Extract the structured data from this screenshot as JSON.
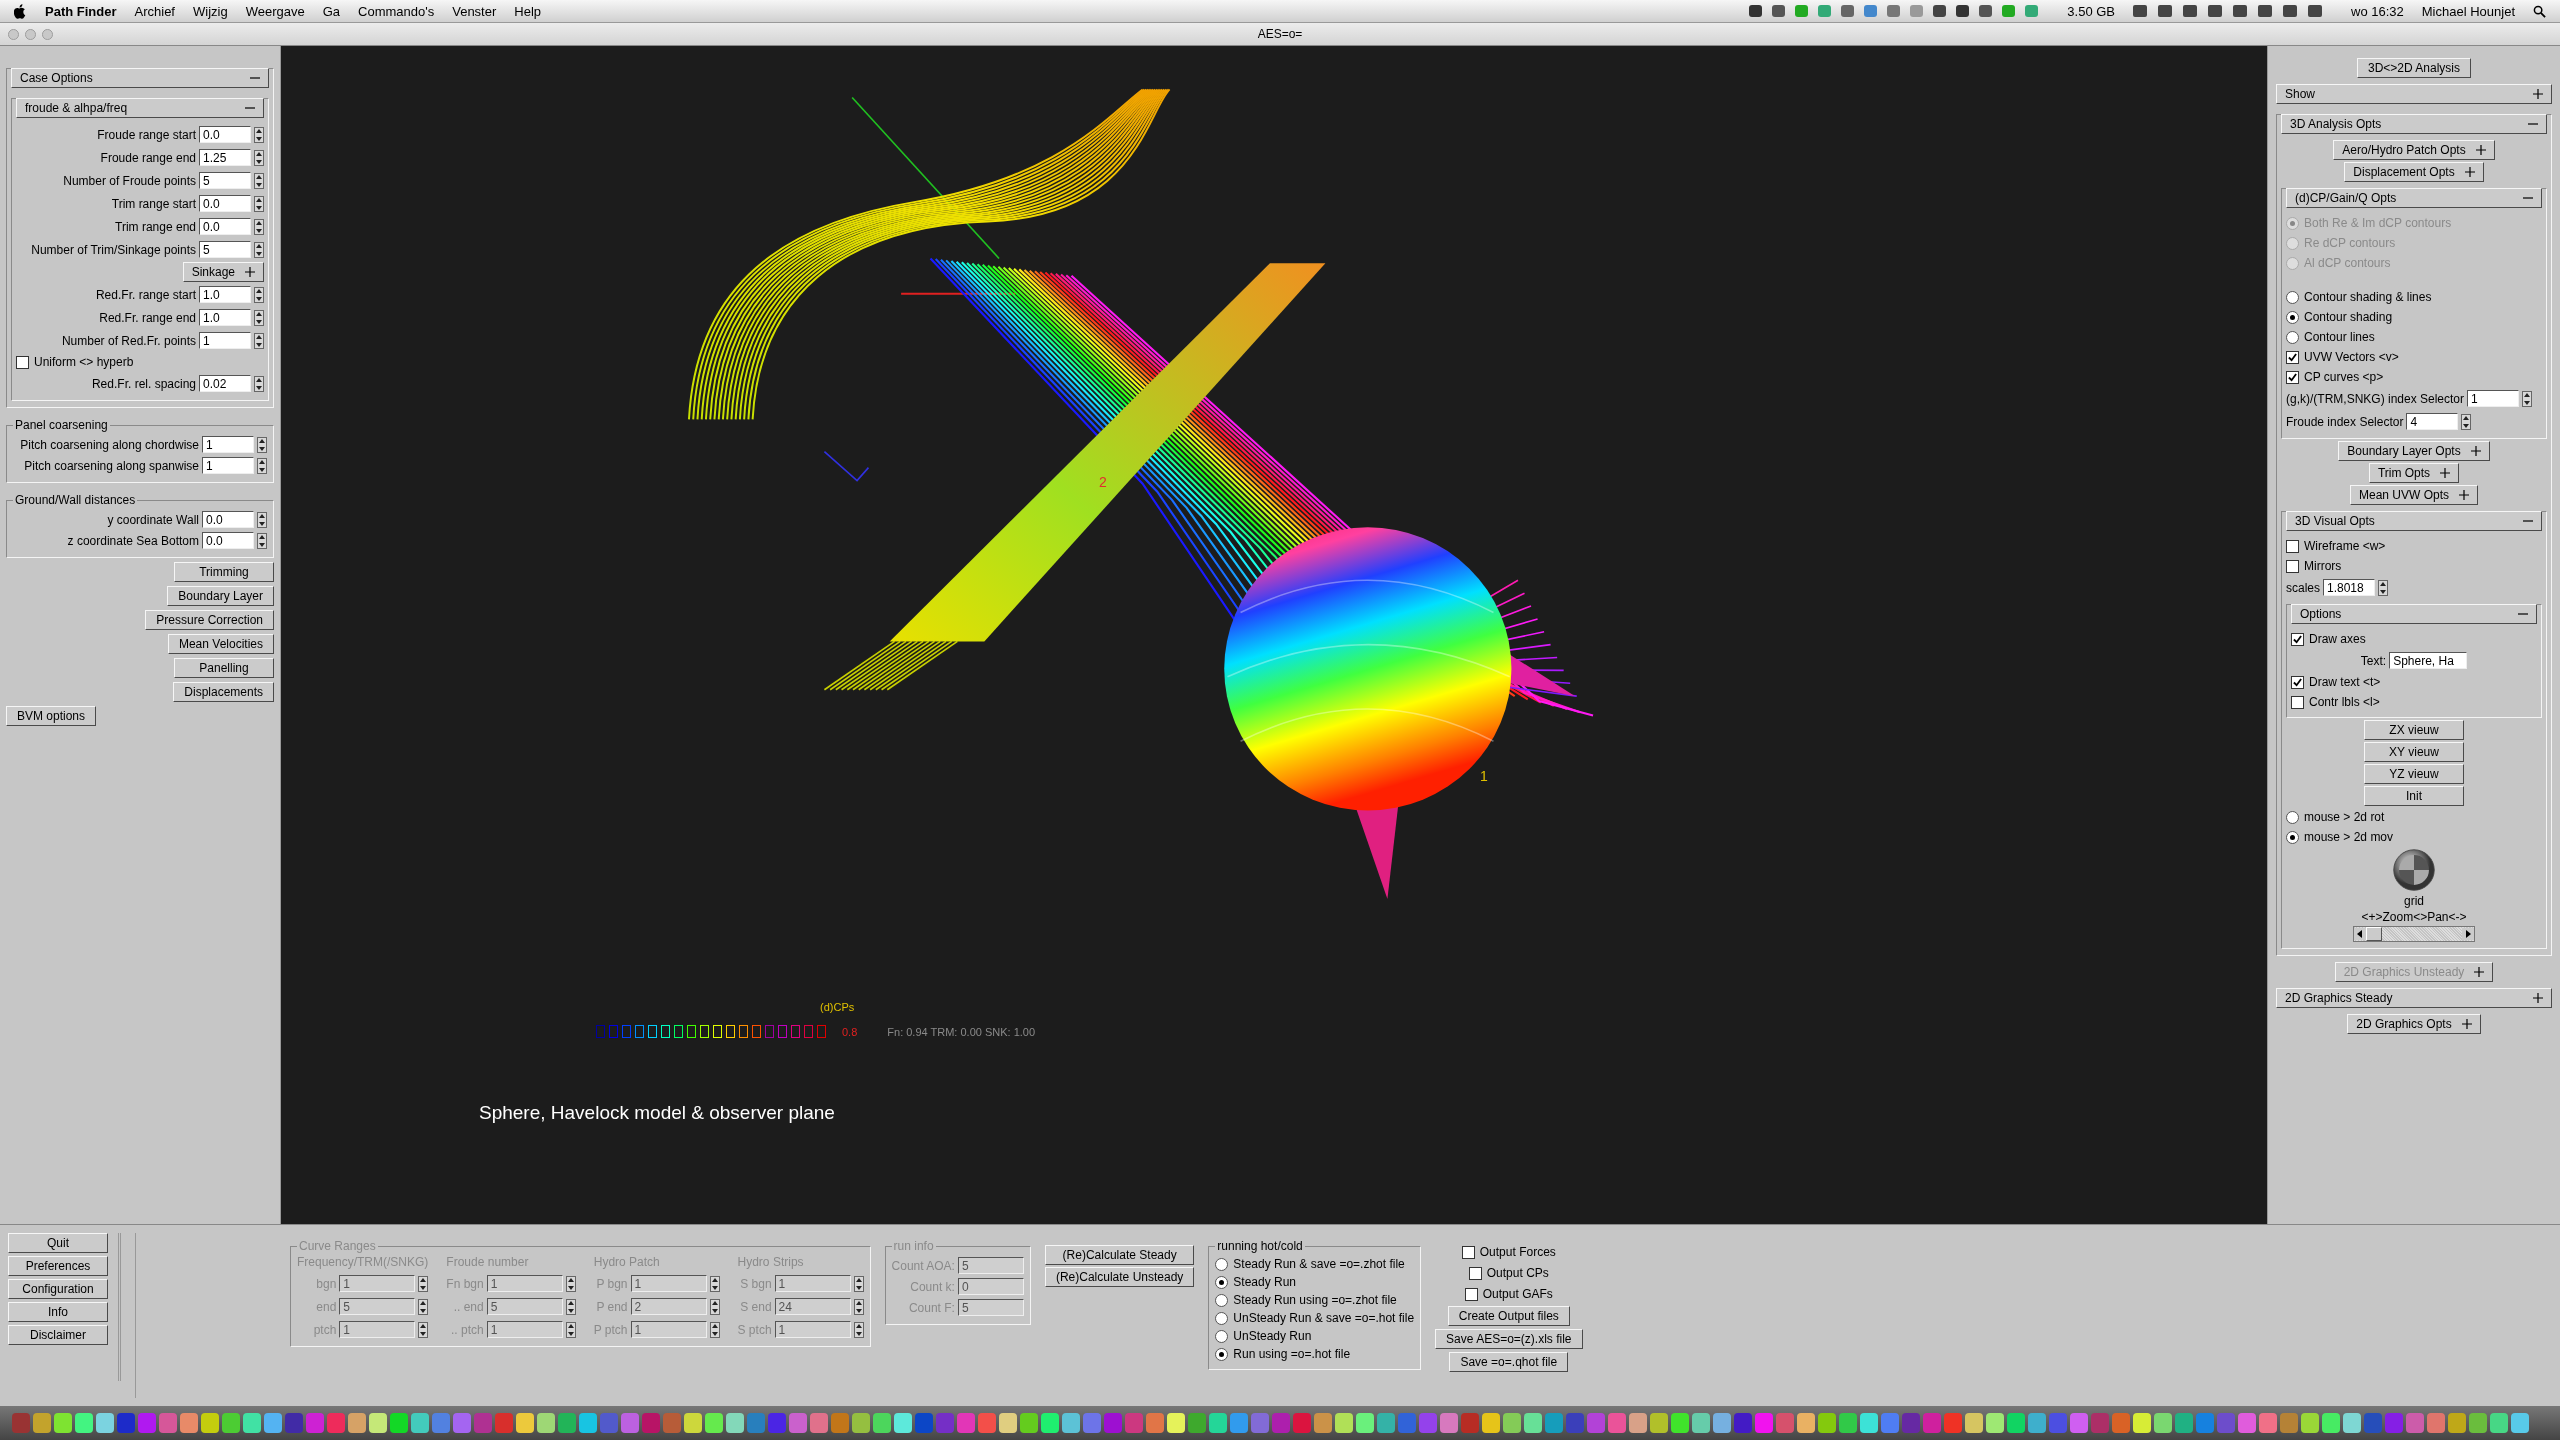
{
  "menu_bar": {
    "app": "Path Finder",
    "menus": [
      "Archief",
      "Wijzig",
      "Weergave",
      "Ga",
      "Commando's",
      "Venster",
      "Help"
    ],
    "memory": "3.50 GB",
    "clock": "wo 16:32",
    "user": "Michael Hounjet"
  },
  "window": {
    "title": "AES=o="
  },
  "left": {
    "items": [
      {
        "kind": "fold",
        "label": "Case Options",
        "expanded": true,
        "disabled": false,
        "children": [
          {
            "kind": "fold",
            "label": "froude & alhpa/freq",
            "expanded": true,
            "disabled": false,
            "children": [
              {
                "kind": "spin",
                "label": "Froude range start",
                "value": "0.0"
              },
              {
                "kind": "spin",
                "label": "Froude range end",
                "value": "1.25"
              },
              {
                "kind": "spin",
                "label": "Number of Froude points",
                "value": "5"
              },
              {
                "kind": "spin",
                "label": "Trim range start",
                "value": "0.0"
              },
              {
                "kind": "spin",
                "label": "Trim range end",
                "value": "0.0"
              },
              {
                "kind": "spin",
                "label": "Number of Trim/Sinkage points",
                "value": "5"
              },
              {
                "kind": "fold",
                "label": "Sinkage",
                "expanded": false,
                "disabled": false
              },
              {
                "kind": "spin",
                "label": "Red.Fr. range start",
                "value": "1.0"
              },
              {
                "kind": "spin",
                "label": "Red.Fr. range end",
                "value": "1.0"
              },
              {
                "kind": "spin",
                "label": "Number of Red.Fr. points",
                "value": "1"
              },
              {
                "kind": "check",
                "label": "Uniform <> hyperb",
                "checked": false
              },
              {
                "kind": "spin",
                "label": "Red.Fr. rel. spacing",
                "value": "0.02"
              }
            ]
          }
        ]
      },
      {
        "kind": "group",
        "title": "Panel coarsening",
        "children": [
          {
            "kind": "spin",
            "label": "Pitch coarsening along chordwise",
            "value": "1"
          },
          {
            "kind": "spin",
            "label": "Pitch coarsening along  spanwise",
            "value": "1"
          }
        ]
      },
      {
        "kind": "group",
        "title": "Ground/Wall distances",
        "children": [
          {
            "kind": "spin",
            "label": "y coordinate Wall",
            "value": "0.0"
          },
          {
            "kind": "spin",
            "label": "z coordinate Sea Bottom",
            "value": "0.0"
          }
        ]
      },
      {
        "kind": "button",
        "label": "Trimming"
      },
      {
        "kind": "button",
        "label": "Boundary Layer"
      },
      {
        "kind": "button",
        "label": "Pressure Correction"
      },
      {
        "kind": "button",
        "label": "Mean Velocities"
      },
      {
        "kind": "button",
        "label": "Panelling"
      },
      {
        "kind": "button",
        "label": "Displacements"
      }
    ],
    "bvm_button": "BVM options"
  },
  "scene": {
    "legend_title": "(d)CPs",
    "legend_max": "0.8",
    "state": "Fn: 0.94 TRM:   0.00 SNK:   1.00",
    "labels": [
      "2",
      "1"
    ],
    "caption": "Sphere, Havelock model & observer plane"
  },
  "right": {
    "items": [
      {
        "kind": "button",
        "label": "3D<>2D Analysis"
      },
      {
        "kind": "bar",
        "label": "Show",
        "expanded": false,
        "disabled": false
      },
      {
        "kind": "bar",
        "label": "3D Analysis Opts",
        "expanded": true,
        "disabled": false,
        "children": [
          {
            "kind": "fold",
            "label": "Aero/Hydro Patch Opts",
            "expanded": false,
            "disabled": false
          },
          {
            "kind": "fold",
            "label": "Displacement  Opts",
            "expanded": false,
            "disabled": false
          },
          {
            "kind": "fold",
            "label": "(d)CP/Gain/Q  Opts",
            "expanded": true,
            "disabled": false,
            "children": [
              {
                "kind": "radio",
                "label": "Both Re & Im dCP contours",
                "selected": true,
                "disabled": true
              },
              {
                "kind": "radio",
                "label": "Re dCP contours",
                "selected": false,
                "disabled": true
              },
              {
                "kind": "radio",
                "label": "Al dCP contours",
                "selected": false,
                "disabled": true
              },
              {
                "kind": "gap"
              },
              {
                "kind": "radio",
                "label": "Contour shading & lines",
                "selected": false,
                "disabled": false
              },
              {
                "kind": "radio",
                "label": "Contour shading",
                "selected": true,
                "disabled": false
              },
              {
                "kind": "radio",
                "label": "Contour lines",
                "selected": false,
                "disabled": false
              },
              {
                "kind": "check",
                "label": "UVW Vectors <v>",
                "checked": true
              },
              {
                "kind": "check",
                "label": "CP  curves  <p>",
                "checked": true
              },
              {
                "kind": "spin",
                "label": "(g,k)/(TRM,SNKG) index Selector",
                "value": "1"
              },
              {
                "kind": "spin",
                "label": "Froude index Selector",
                "value": "4"
              }
            ]
          },
          {
            "kind": "fold",
            "label": "Boundary Layer Opts",
            "expanded": false,
            "disabled": false
          },
          {
            "kind": "fold",
            "label": "Trim  Opts",
            "expanded": false,
            "disabled": false
          },
          {
            "kind": "fold",
            "label": "Mean UVW Opts",
            "expanded": false,
            "disabled": false
          },
          {
            "kind": "fold",
            "label": "3D Visual Opts",
            "expanded": true,
            "disabled": false,
            "children": [
              {
                "kind": "check",
                "label": "Wireframe <w>",
                "checked": false
              },
              {
                "kind": "check",
                "label": "Mirrors",
                "checked": false
              },
              {
                "kind": "spin",
                "label": "scales",
                "value": "1.8018"
              },
              {
                "kind": "fold",
                "label": "Options",
                "expanded": true,
                "disabled": false,
                "children": [
                  {
                    "kind": "check",
                    "label": "Draw axes",
                    "checked": true
                  },
                  {
                    "kind": "text",
                    "label": "Text:",
                    "value": "Sphere, Ha"
                  },
                  {
                    "kind": "check",
                    "label": "Draw  text <t>",
                    "checked": true
                  },
                  {
                    "kind": "check",
                    "label": "Contr lbls <l>",
                    "checked": false
                  }
                ]
              },
              {
                "kind": "button",
                "label": "ZX vieuw"
              },
              {
                "kind": "button",
                "label": "XY vieuw"
              },
              {
                "kind": "button",
                "label": "YZ vieuw"
              },
              {
                "kind": "button",
                "label": "Init"
              },
              {
                "kind": "radio",
                "label": "mouse > 2d rot",
                "selected": false,
                "disabled": false
              },
              {
                "kind": "radio",
                "label": "mouse > 2d mov",
                "selected": true,
                "disabled": false
              },
              {
                "kind": "trackball"
              },
              {
                "kind": "label",
                "label": "grid"
              },
              {
                "kind": "label",
                "label": "<+>Zoom<>Pan<->"
              },
              {
                "kind": "scrollbar"
              }
            ]
          }
        ]
      },
      {
        "kind": "fold",
        "label": "2D Graphics Unsteady",
        "expanded": false,
        "disabled": true
      },
      {
        "kind": "bar",
        "label": "2D Graphics Steady",
        "expanded": false,
        "disabled": false
      },
      {
        "kind": "fold",
        "label": "2D Graphics Opts",
        "expanded": false,
        "disabled": false
      }
    ]
  },
  "bottom": {
    "side_buttons": [
      "Quit",
      "Preferences",
      "Configuration",
      "Info",
      "Disclaimer"
    ],
    "curve_ranges": {
      "title": "Curve Ranges",
      "disabled": true,
      "columns": [
        {
          "heading": "Frequency/TRM(/SNKG)",
          "rows": [
            {
              "label": "bgn",
              "value": "1"
            },
            {
              "label": "end",
              "value": "5"
            },
            {
              "label": "ptch",
              "value": "1"
            }
          ]
        },
        {
          "heading": "Froude number",
          "rows": [
            {
              "label": "Fn bgn",
              "value": "1"
            },
            {
              "label": ".. end",
              "value": "5"
            },
            {
              "label": ".. ptch",
              "value": "1"
            }
          ]
        },
        {
          "heading": "Hydro Patch",
          "rows": [
            {
              "label": "P bgn",
              "value": "1"
            },
            {
              "label": "P end",
              "value": "2"
            },
            {
              "label": "P ptch",
              "value": "1"
            }
          ]
        },
        {
          "heading": "Hydro Strips",
          "rows": [
            {
              "label": "S bgn",
              "value": "1"
            },
            {
              "label": "S end",
              "value": "24"
            },
            {
              "label": "S ptch",
              "value": "1"
            }
          ]
        }
      ]
    },
    "run_info": {
      "title": "run info",
      "disabled": true,
      "rows": [
        {
          "label": "Count AOA:",
          "value": "5"
        },
        {
          "label": "Count k:",
          "value": "0"
        },
        {
          "label": "Count F:",
          "value": "5"
        }
      ]
    },
    "calc_buttons": [
      "(Re)Calculate Steady",
      "(Re)Calculate Unsteady"
    ],
    "running": {
      "title": "running hot/cold",
      "options": [
        {
          "label": "Steady Run & save =o=.zhot file",
          "selected": false
        },
        {
          "label": "Steady Run",
          "selected": true
        },
        {
          "label": "Steady Run  using =o=.zhot file",
          "selected": false
        },
        {
          "label": "UnSteady Run & save =o=.hot file",
          "selected": false
        },
        {
          "label": "UnSteady Run",
          "selected": false
        },
        {
          "label": "        Run  using =o=.hot file",
          "selected": true
        }
      ]
    },
    "outputs": [
      {
        "label": "Output Forces",
        "checked": false
      },
      {
        "label": "Output CPs",
        "checked": false
      },
      {
        "label": "Output GAFs",
        "checked": false
      }
    ],
    "output_buttons": [
      "Create Output files",
      "Save AES=o=(z).xls file",
      "Save =o=.qhot file"
    ]
  }
}
